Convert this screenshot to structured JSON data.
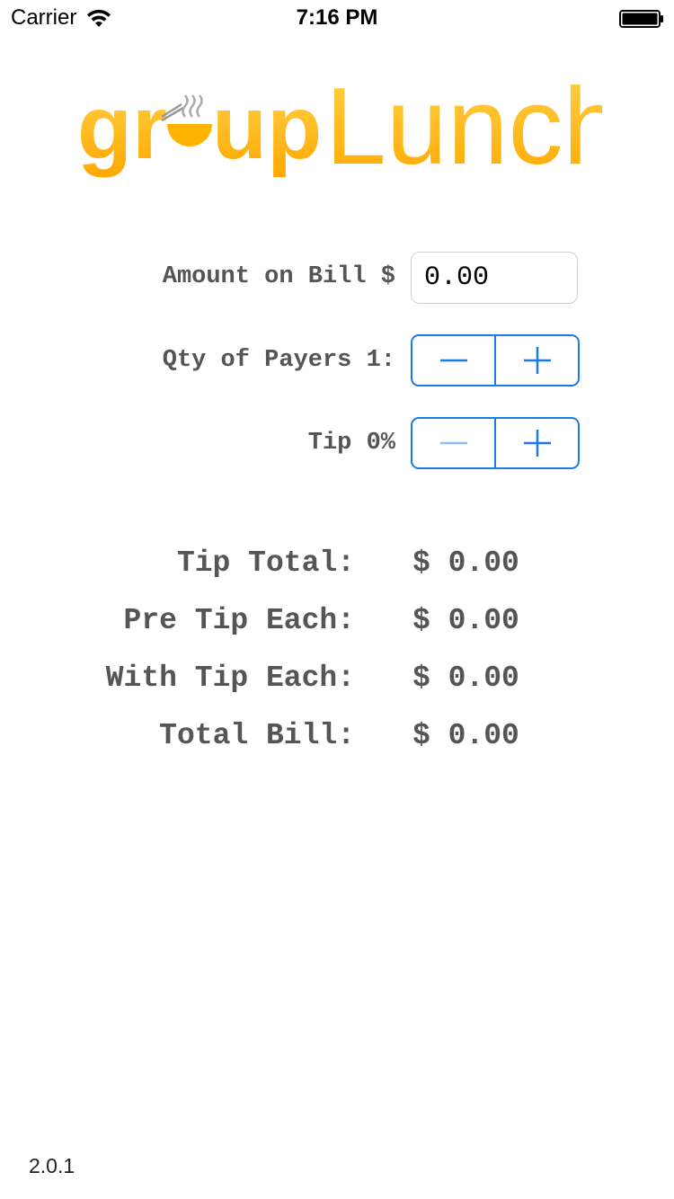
{
  "status_bar": {
    "carrier": "Carrier",
    "time": "7:16 PM"
  },
  "logo": {
    "part1": "gr",
    "part2": "up",
    "part3": "Lunch",
    "color": "#ffb400"
  },
  "form": {
    "amount_label": "Amount on Bill $",
    "amount_value": "0.00",
    "payers_label": "Qty of Payers 1:",
    "tip_label": "Tip 0%"
  },
  "results": [
    {
      "label": "Tip Total:",
      "value": "$ 0.00"
    },
    {
      "label": "Pre Tip Each:",
      "value": "$ 0.00"
    },
    {
      "label": "With Tip Each:",
      "value": "$ 0.00"
    },
    {
      "label": "Total Bill:",
      "value": "$ 0.00"
    }
  ],
  "version": "2.0.1",
  "colors": {
    "accent": "#1a7ae8",
    "accent_disabled": "#8fbff2",
    "label_gray": "#555555"
  }
}
